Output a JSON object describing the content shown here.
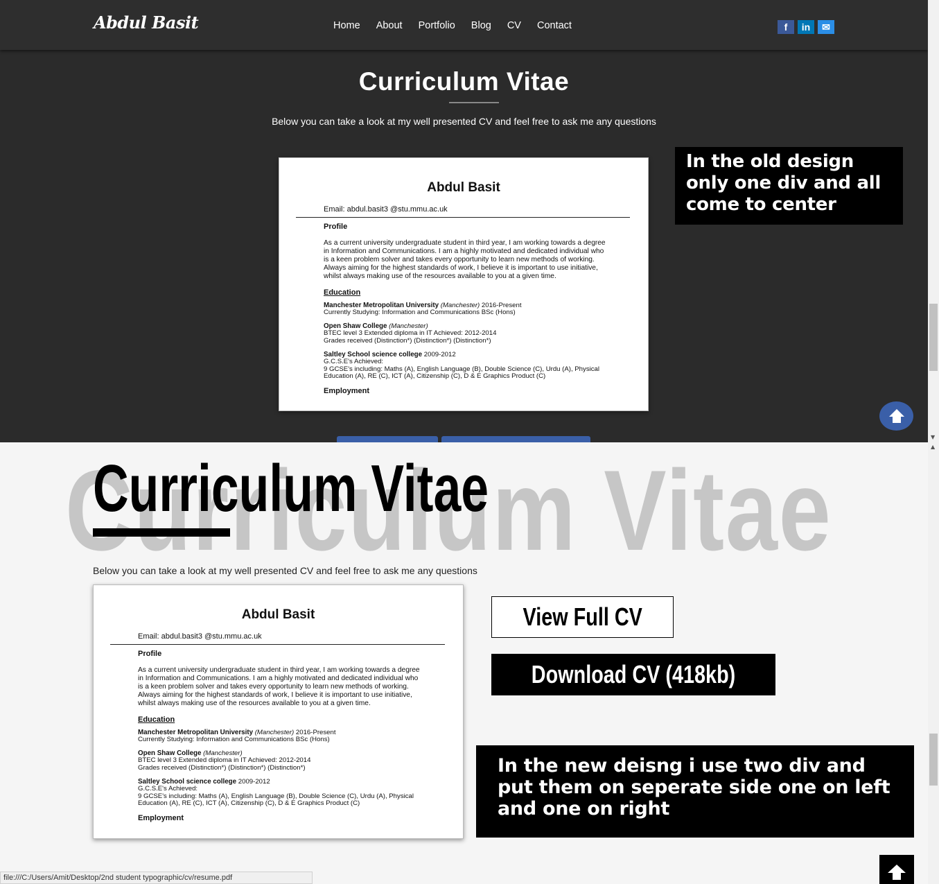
{
  "old_design": {
    "logo": "Abdul Basit",
    "nav": [
      "Home",
      "About",
      "Portfolio",
      "Blog",
      "CV",
      "Contact"
    ],
    "social": [
      {
        "icon": "facebook-icon",
        "glyph": "f",
        "color": "#3b5998"
      },
      {
        "icon": "linkedin-icon",
        "glyph": "in",
        "color": "#0077b5"
      },
      {
        "icon": "mail-icon",
        "glyph": "✉",
        "color": "#2b8ee6"
      }
    ],
    "title": "Curriculum Vitae",
    "subtitle": "Below you can take a look at my well presented CV and feel free to ask me any questions",
    "note": "In the old design only one div and all come to center",
    "background_color": "#2b2b2b",
    "accent_color": "#3a5fa8"
  },
  "cv_document": {
    "name": "Abdul Basit",
    "email": "Email:  abdul.basit3  @stu.mmu.ac.uk",
    "profile_heading": "Profile",
    "profile_text": "As a current university undergraduate student in third year, I am working towards a degree in Information and Communications.  I am a highly motivated and dedicated individual who is a keen problem solver and takes every opportunity to learn new methods of working. Always aiming for the highest standards of work, I believe it is important to use initiative, whilst always making use of the resources available to you at a given time.",
    "education_heading": "Education",
    "education": [
      {
        "school": "Manchester Metropolitan University",
        "place": "(Manchester)",
        "dates": "2016-Present",
        "lines": [
          "Currently Studying: Information and Communications BSc (Hons)"
        ]
      },
      {
        "school": "Open Shaw College",
        "place": "(Manchester)",
        "dates": "",
        "lines": [
          "BTEC level 3 Extended diploma in IT Achieved: 2012-2014",
          "Grades received (Distinction*) (Distinction*) (Distinction*)"
        ]
      },
      {
        "school": "Saltley School science college",
        "place": "",
        "dates": "2009-2012",
        "lines": [
          "G.C.S.E's Achieved:",
          "9 GCSE's including: Maths (A), English Language (B), Double Science (C), Urdu (A), Physical Education (A), RE (C), ICT (A), Citizenship (C), D & E Graphics Product (C)"
        ]
      }
    ],
    "next_heading": "Employment"
  },
  "new_design": {
    "title": "Curriculum Vitae",
    "subtitle": "Below you can take a look at my well presented CV and feel free to ask me any questions",
    "view_button": "View Full CV",
    "download_button": "Download CV (418kb)",
    "note": "In the new deisng i use two div and put them on seperate side one on left and one on right",
    "background_color": "#f5f5f5",
    "accent_color": "#000000"
  },
  "status_bar": "file:///C:/Users/Amit/Desktop/2nd student typographic/cv/resume.pdf"
}
